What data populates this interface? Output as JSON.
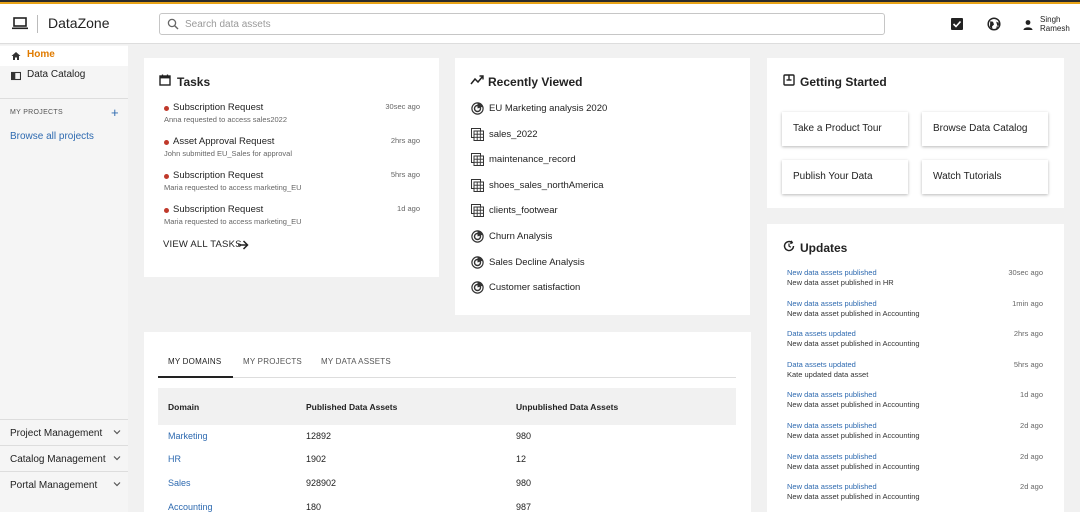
{
  "app": {
    "name": "DataZone"
  },
  "search": {
    "placeholder": "Search data assets"
  },
  "user": {
    "first": "Singh",
    "last": "Ramesh"
  },
  "sidebar": {
    "items": [
      {
        "label": "Home"
      },
      {
        "label": "Data Catalog"
      }
    ],
    "projects_heading": "MY PROJECTS",
    "add_symbol": "+",
    "browse_link": "Browse all projects",
    "bottom": [
      {
        "label": "Project Management"
      },
      {
        "label": "Catalog Management"
      },
      {
        "label": "Portal Management"
      }
    ]
  },
  "tasks": {
    "title": "Tasks",
    "items": [
      {
        "title": "Subscription Request",
        "detail": "Anna requested to access sales2022",
        "time": "30sec ago"
      },
      {
        "title": "Asset Approval Request",
        "detail": "John submitted EU_Sales for approval",
        "time": "2hrs ago"
      },
      {
        "title": "Subscription Request",
        "detail": "Maria requested to access marketing_EU",
        "time": "5hrs ago"
      },
      {
        "title": "Subscription Request",
        "detail": "Maria requested to access marketing_EU",
        "time": "1d ago"
      }
    ],
    "view_all": "VIEW ALL TASKS"
  },
  "recent": {
    "title": "Recently Viewed",
    "items": [
      {
        "label": "EU Marketing analysis 2020",
        "icon": "analysis-icon"
      },
      {
        "label": "sales_2022",
        "icon": "table-icon"
      },
      {
        "label": "maintenance_record",
        "icon": "table-icon"
      },
      {
        "label": "shoes_sales_northAmerica",
        "icon": "table-icon"
      },
      {
        "label": "clients_footwear",
        "icon": "table-icon"
      },
      {
        "label": "Churn Analysis",
        "icon": "analysis-icon"
      },
      {
        "label": "Sales Decline Analysis",
        "icon": "analysis-icon"
      },
      {
        "label": "Customer satisfaction",
        "icon": "analysis-icon"
      }
    ]
  },
  "getting_started": {
    "title": "Getting Started",
    "buttons": [
      {
        "label": "Take a Product Tour"
      },
      {
        "label": "Browse Data Catalog"
      },
      {
        "label": "Publish Your Data"
      },
      {
        "label": "Watch Tutorials"
      }
    ]
  },
  "updates": {
    "title": "Updates",
    "items": [
      {
        "title": "New data assets published",
        "detail": "New data asset published in HR",
        "time": "30sec ago"
      },
      {
        "title": "New data assets published",
        "detail": "New data asset published in Accounting",
        "time": "1min ago"
      },
      {
        "title": "Data assets updated",
        "detail": "New data asset published in Accounting",
        "time": "2hrs ago"
      },
      {
        "title": "Data assets updated",
        "detail": "Kate updated data asset",
        "time": "5hrs ago"
      },
      {
        "title": "New data assets published",
        "detail": "New data asset published in Accounting",
        "time": "1d ago"
      },
      {
        "title": "New data assets published",
        "detail": "New data asset published in Accounting",
        "time": "2d ago"
      },
      {
        "title": "New data assets published",
        "detail": "New data asset published in Accounting",
        "time": "2d ago"
      },
      {
        "title": "New data assets published",
        "detail": "New data asset published in Accounting",
        "time": "2d ago"
      }
    ]
  },
  "domains": {
    "tabs": [
      {
        "label": "MY DOMAINS"
      },
      {
        "label": "MY PROJECTS"
      },
      {
        "label": "MY DATA ASSETS"
      }
    ],
    "columns": [
      "Domain",
      "Published Data Assets",
      "Unpublished Data Assets"
    ],
    "rows": [
      {
        "domain": "Marketing",
        "published": "12892",
        "unpublished": "980"
      },
      {
        "domain": "HR",
        "published": "1902",
        "unpublished": "12"
      },
      {
        "domain": "Sales",
        "published": "928902",
        "unpublished": "980"
      },
      {
        "domain": "Accounting",
        "published": "180",
        "unpublished": "987"
      }
    ]
  },
  "colors": {
    "accent": "#e8a317",
    "link": "#2e6ab0",
    "home_active": "#e07b00",
    "task_dot": "#c0392b"
  }
}
